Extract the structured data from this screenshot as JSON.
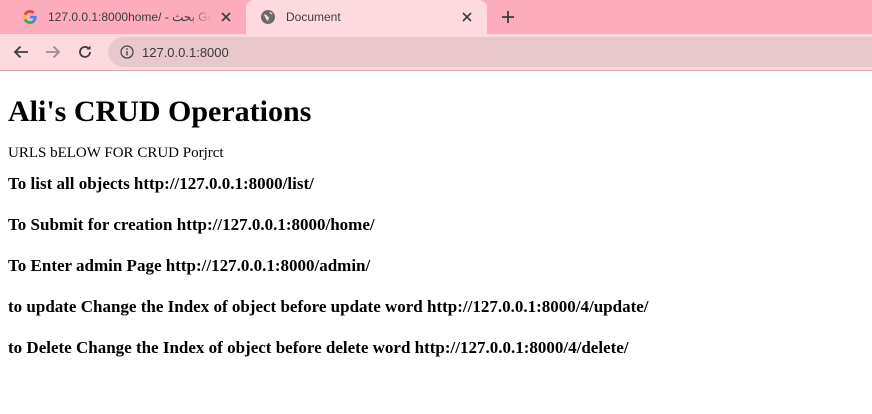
{
  "browser": {
    "tabs": [
      {
        "title": "127.0.0.1:8000home/ - بحث Google",
        "active": false,
        "favicon": "google-g-icon"
      },
      {
        "title": "Document",
        "active": true,
        "favicon": "globe-icon"
      }
    ],
    "address": "127.0.0.1:8000",
    "accent_color": "#fcacbd",
    "toolbar_color": "#ffd9e0"
  },
  "page": {
    "heading": "Ali's CRUD Operations",
    "subtitle": "URLS bELOW FOR CRUD Porjrct",
    "items": [
      "To list all objects http://127.0.0.1:8000/list/",
      "To Submit for creation http://127.0.0.1:8000/home/",
      "To Enter admin Page http://127.0.0.1:8000/admin/",
      "to update Change the Index of object before update word http://127.0.0.1:8000/4/update/",
      "to Delete Change the Index of object before delete word http://127.0.0.1:8000/4/delete/"
    ]
  }
}
